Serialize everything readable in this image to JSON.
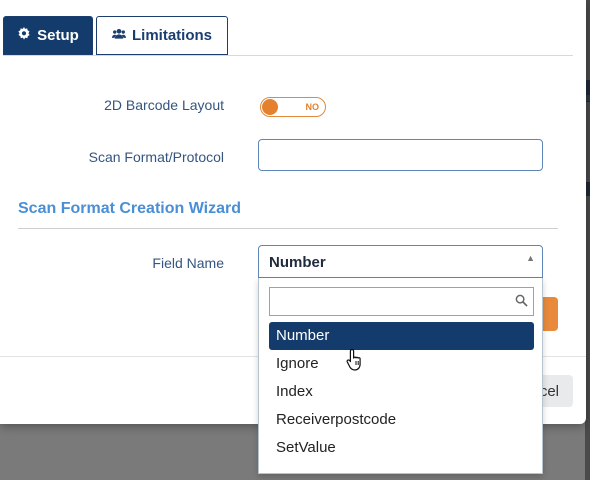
{
  "tabs": [
    {
      "label": "Setup",
      "icon": "gear-icon",
      "active": true
    },
    {
      "label": "Limitations",
      "icon": "users-icon",
      "active": false
    }
  ],
  "form": {
    "barcode_layout_label": "2D Barcode Layout",
    "barcode_layout_toggle_text": "NO",
    "scan_format_label": "Scan Format/Protocol",
    "scan_format_value": "",
    "wizard_title": "Scan Format Creation Wizard",
    "field_name_label": "Field Name",
    "field_name_value": "Number"
  },
  "dropdown": {
    "search_value": "",
    "options": [
      "Number",
      "Ignore",
      "Index",
      "Receiverpostcode",
      "SetValue"
    ],
    "selected": "Number"
  },
  "footer": {
    "cancel_label_visible": "cel"
  },
  "colors": {
    "primary": "#133b6b",
    "accent": "#e5812e",
    "section_title": "#4a8fd6"
  }
}
